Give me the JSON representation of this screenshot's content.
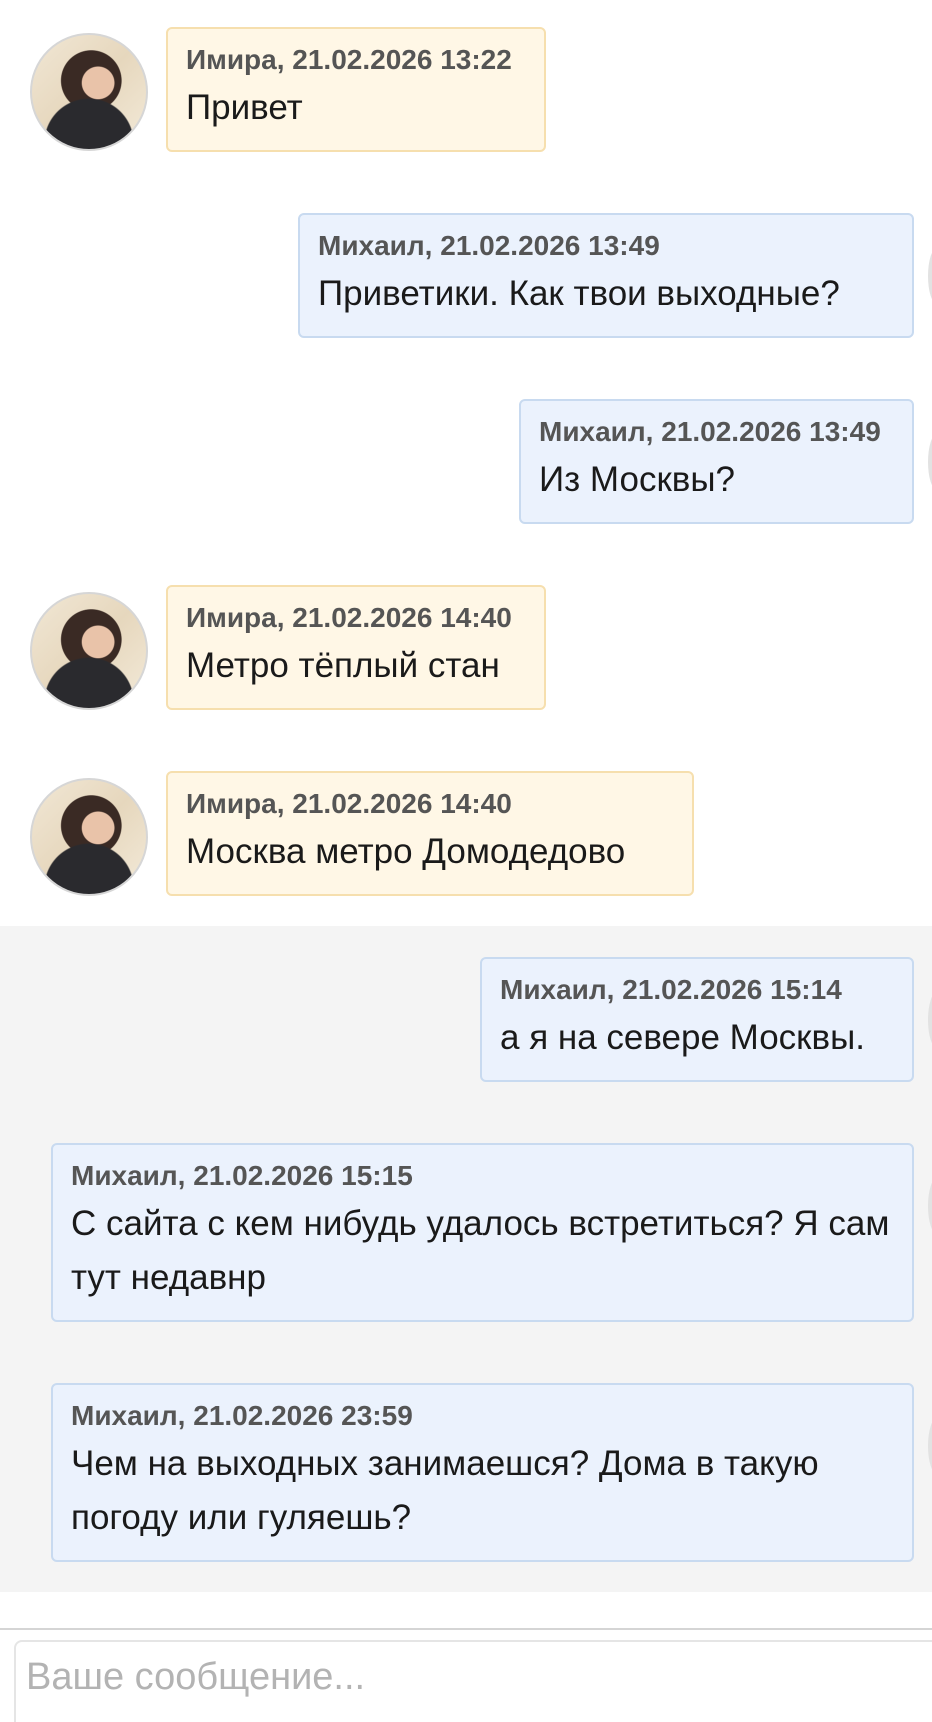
{
  "messages": [
    {
      "author": "Имира, 21.02.2026 13:22",
      "text": "Привет"
    },
    {
      "author": "Михаил, 21.02.2026 13:49",
      "text": "Приветики. Как твои выходные?"
    },
    {
      "author": "Михаил, 21.02.2026 13:49",
      "text": "Из Москвы?"
    },
    {
      "author": "Имира, 21.02.2026 14:40",
      "text": "Метро тёплый стан"
    },
    {
      "author": "Имира, 21.02.2026 14:40",
      "text": "Москва метро Домодедово"
    },
    {
      "author": "Михаил, 21.02.2026 15:14",
      "text": "а я на севере Москвы."
    },
    {
      "author": "Михаил, 21.02.2026 15:15",
      "text": "С сайта с кем нибудь удалось встретиться? Я сам тут недавнр"
    },
    {
      "author": "Михаил, 21.02.2026 23:59",
      "text": "Чем на выходных занимаешся? Дома в такую погоду или гуляешь?"
    }
  ],
  "composer": {
    "placeholder": "Ваше сообщение..."
  },
  "colors": {
    "incoming_bg": "#fff7e6",
    "incoming_border": "#f6dfae",
    "outgoing_bg": "#ebf2fd",
    "outgoing_border": "#c8daf0",
    "unread_bg": "#f4f4f4"
  }
}
